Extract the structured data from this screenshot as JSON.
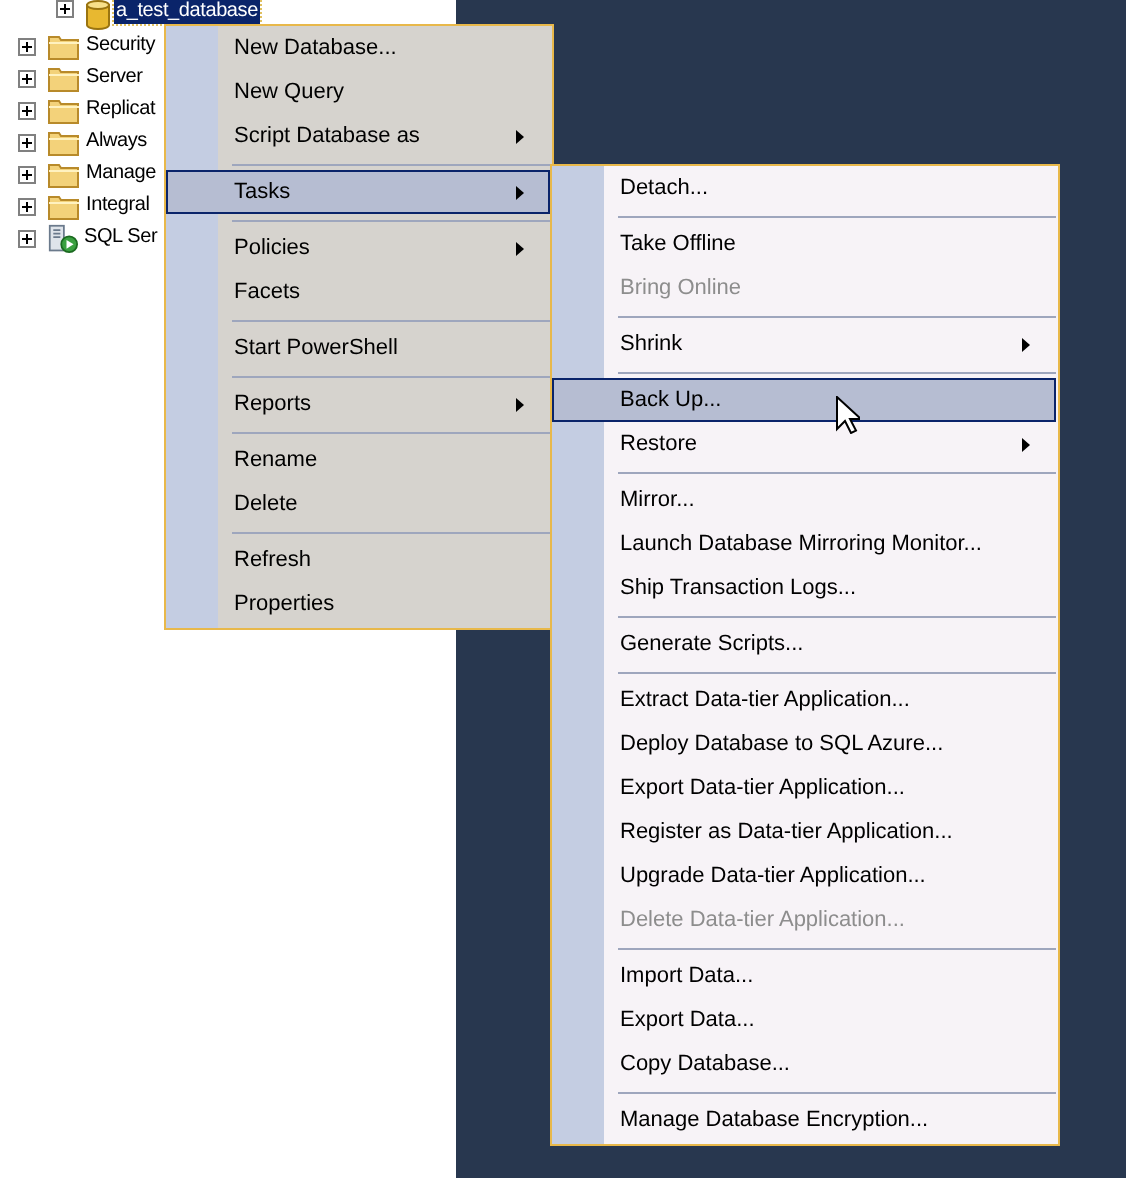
{
  "tree": [
    {
      "label": "a_test_database",
      "kind": "database",
      "selected": true,
      "expanded": false
    },
    {
      "label": "Security",
      "kind": "folder",
      "selected": false,
      "expanded": false
    },
    {
      "label": "Server",
      "kind": "folder",
      "selected": false,
      "expanded": false
    },
    {
      "label": "Replicat",
      "kind": "folder",
      "selected": false,
      "expanded": false
    },
    {
      "label": "Always",
      "kind": "folder",
      "selected": false,
      "expanded": false
    },
    {
      "label": "Manage",
      "kind": "folder",
      "selected": false,
      "expanded": false
    },
    {
      "label": "Integral",
      "kind": "folder",
      "selected": false,
      "expanded": false
    },
    {
      "label": "SQL Ser",
      "kind": "agent",
      "selected": false,
      "expanded": false
    }
  ],
  "context_menu": {
    "items": [
      {
        "kind": "item",
        "label": "New Database...",
        "selected": false,
        "disabled": false,
        "submenu": false
      },
      {
        "kind": "item",
        "label": "New Query",
        "selected": false,
        "disabled": false,
        "submenu": false
      },
      {
        "kind": "item",
        "label": "Script Database as",
        "selected": false,
        "disabled": false,
        "submenu": true
      },
      {
        "kind": "separator"
      },
      {
        "kind": "item",
        "label": "Tasks",
        "selected": true,
        "disabled": false,
        "submenu": true
      },
      {
        "kind": "separator"
      },
      {
        "kind": "item",
        "label": "Policies",
        "selected": false,
        "disabled": false,
        "submenu": true
      },
      {
        "kind": "item",
        "label": "Facets",
        "selected": false,
        "disabled": false,
        "submenu": false
      },
      {
        "kind": "separator"
      },
      {
        "kind": "item",
        "label": "Start PowerShell",
        "selected": false,
        "disabled": false,
        "submenu": false
      },
      {
        "kind": "separator"
      },
      {
        "kind": "item",
        "label": "Reports",
        "selected": false,
        "disabled": false,
        "submenu": true
      },
      {
        "kind": "separator"
      },
      {
        "kind": "item",
        "label": "Rename",
        "selected": false,
        "disabled": false,
        "submenu": false
      },
      {
        "kind": "item",
        "label": "Delete",
        "selected": false,
        "disabled": false,
        "submenu": false
      },
      {
        "kind": "separator"
      },
      {
        "kind": "item",
        "label": "Refresh",
        "selected": false,
        "disabled": false,
        "submenu": false
      },
      {
        "kind": "item",
        "label": "Properties",
        "selected": false,
        "disabled": false,
        "submenu": false
      }
    ]
  },
  "tasks_submenu": {
    "items": [
      {
        "kind": "item",
        "label": "Detach...",
        "selected": false,
        "disabled": false,
        "submenu": false
      },
      {
        "kind": "separator"
      },
      {
        "kind": "item",
        "label": "Take Offline",
        "selected": false,
        "disabled": false,
        "submenu": false
      },
      {
        "kind": "item",
        "label": "Bring Online",
        "selected": false,
        "disabled": true,
        "submenu": false
      },
      {
        "kind": "separator"
      },
      {
        "kind": "item",
        "label": "Shrink",
        "selected": false,
        "disabled": false,
        "submenu": true
      },
      {
        "kind": "separator"
      },
      {
        "kind": "item",
        "label": "Back Up...",
        "selected": true,
        "disabled": false,
        "submenu": false
      },
      {
        "kind": "item",
        "label": "Restore",
        "selected": false,
        "disabled": false,
        "submenu": true
      },
      {
        "kind": "separator"
      },
      {
        "kind": "item",
        "label": "Mirror...",
        "selected": false,
        "disabled": false,
        "submenu": false
      },
      {
        "kind": "item",
        "label": "Launch Database Mirroring Monitor...",
        "selected": false,
        "disabled": false,
        "submenu": false
      },
      {
        "kind": "item",
        "label": "Ship Transaction Logs...",
        "selected": false,
        "disabled": false,
        "submenu": false
      },
      {
        "kind": "separator"
      },
      {
        "kind": "item",
        "label": "Generate Scripts...",
        "selected": false,
        "disabled": false,
        "submenu": false
      },
      {
        "kind": "separator"
      },
      {
        "kind": "item",
        "label": "Extract Data-tier Application...",
        "selected": false,
        "disabled": false,
        "submenu": false
      },
      {
        "kind": "item",
        "label": "Deploy Database to SQL Azure...",
        "selected": false,
        "disabled": false,
        "submenu": false
      },
      {
        "kind": "item",
        "label": "Export Data-tier Application...",
        "selected": false,
        "disabled": false,
        "submenu": false
      },
      {
        "kind": "item",
        "label": "Register as Data-tier Application...",
        "selected": false,
        "disabled": false,
        "submenu": false
      },
      {
        "kind": "item",
        "label": "Upgrade Data-tier Application...",
        "selected": false,
        "disabled": false,
        "submenu": false
      },
      {
        "kind": "item",
        "label": "Delete Data-tier Application...",
        "selected": false,
        "disabled": true,
        "submenu": false
      },
      {
        "kind": "separator"
      },
      {
        "kind": "item",
        "label": "Import Data...",
        "selected": false,
        "disabled": false,
        "submenu": false
      },
      {
        "kind": "item",
        "label": "Export Data...",
        "selected": false,
        "disabled": false,
        "submenu": false
      },
      {
        "kind": "item",
        "label": "Copy Database...",
        "selected": false,
        "disabled": false,
        "submenu": false
      },
      {
        "kind": "separator"
      },
      {
        "kind": "item",
        "label": "Manage Database Encryption...",
        "selected": false,
        "disabled": false,
        "submenu": false
      }
    ]
  }
}
